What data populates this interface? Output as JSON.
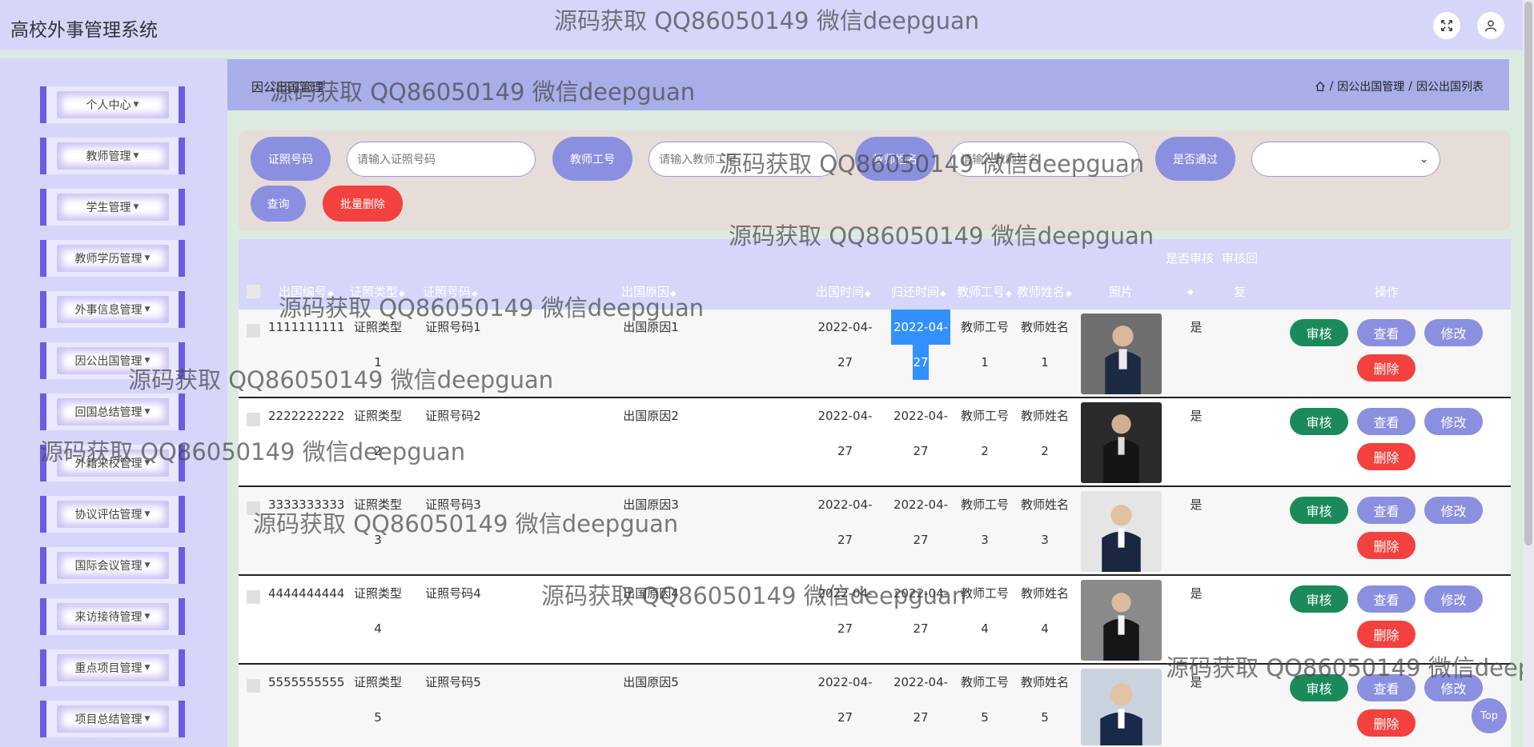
{
  "app": {
    "title": "高校外事管理系统"
  },
  "sidebar": {
    "items": [
      {
        "label": "个人中心"
      },
      {
        "label": "教师管理"
      },
      {
        "label": "学生管理"
      },
      {
        "label": "教师学历管理"
      },
      {
        "label": "外事信息管理"
      },
      {
        "label": "因公出国管理"
      },
      {
        "label": "回国总结管理"
      },
      {
        "label": "外籍来校管理"
      },
      {
        "label": "协议评估管理"
      },
      {
        "label": "国际会议管理"
      },
      {
        "label": "来访接待管理"
      },
      {
        "label": "重点项目管理"
      },
      {
        "label": "项目总结管理"
      }
    ]
  },
  "header": {
    "title": "因公出国管理",
    "breadcrumb": [
      "因公出国管理",
      "因公出国列表"
    ],
    "sep": "/"
  },
  "search": {
    "cert_no_label": "证照号码",
    "cert_no_placeholder": "请输入证照号码",
    "teacher_no_label": "教师工号",
    "teacher_no_placeholder": "请输入教师工号",
    "teacher_name_label": "教师姓名",
    "teacher_name_placeholder": "请输入教师姓名",
    "passed_label": "是否通过",
    "query_label": "查询",
    "batch_delete_label": "批量删除"
  },
  "table": {
    "headers": {
      "outbound_no": "出国编号",
      "cert_type": "证照类型",
      "cert_no": "证照号码",
      "reason": "出国原因",
      "out_time": "出国时间",
      "return_time": "归还时间",
      "teacher_no": "教师工号",
      "teacher_name": "教师姓名",
      "photo": "照片",
      "audit": "是否审核",
      "audit_reply_1": "审核回",
      "audit_reply_2": "复",
      "actions": "操作"
    },
    "rows": [
      {
        "no": "1111111111",
        "type_a": "证照类型",
        "type_b": "1",
        "cert": "证照号码1",
        "reason": "出国原因1",
        "out_a": "2022-04-",
        "out_b": "27",
        "ret_a": "2022-04-",
        "ret_b": "27",
        "tno_a": "教师工号",
        "tno_b": "1",
        "tname_a": "教师姓名",
        "tname_b": "1",
        "audit": "是"
      },
      {
        "no": "2222222222",
        "type_a": "证照类型",
        "type_b": "2",
        "cert": "证照号码2",
        "reason": "出国原因2",
        "out_a": "2022-04-",
        "out_b": "27",
        "ret_a": "2022-04-",
        "ret_b": "27",
        "tno_a": "教师工号",
        "tno_b": "2",
        "tname_a": "教师姓名",
        "tname_b": "2",
        "audit": "是"
      },
      {
        "no": "3333333333",
        "type_a": "证照类型",
        "type_b": "3",
        "cert": "证照号码3",
        "reason": "出国原因3",
        "out_a": "2022-04-",
        "out_b": "27",
        "ret_a": "2022-04-",
        "ret_b": "27",
        "tno_a": "教师工号",
        "tno_b": "3",
        "tname_a": "教师姓名",
        "tname_b": "3",
        "audit": "是"
      },
      {
        "no": "4444444444",
        "type_a": "证照类型",
        "type_b": "4",
        "cert": "证照号码4",
        "reason": "出国原因4",
        "out_a": "2022-04-",
        "out_b": "27",
        "ret_a": "2022-04-",
        "ret_b": "27",
        "tno_a": "教师工号",
        "tno_b": "4",
        "tname_a": "教师姓名",
        "tname_b": "4",
        "audit": "是"
      },
      {
        "no": "5555555555",
        "type_a": "证照类型",
        "type_b": "5",
        "cert": "证照号码5",
        "reason": "出国原因5",
        "out_a": "2022-04-",
        "out_b": "27",
        "ret_a": "2022-04-",
        "ret_b": "27",
        "tno_a": "教师工号",
        "tno_b": "5",
        "tname_a": "教师姓名",
        "tname_b": "5",
        "audit": "是"
      }
    ],
    "actions": {
      "audit": "审核",
      "view": "查看",
      "edit": "修改",
      "delete": "删除"
    }
  },
  "watermark": "源码获取 QQ86050149 微信deepguan",
  "top_button": "Top"
}
